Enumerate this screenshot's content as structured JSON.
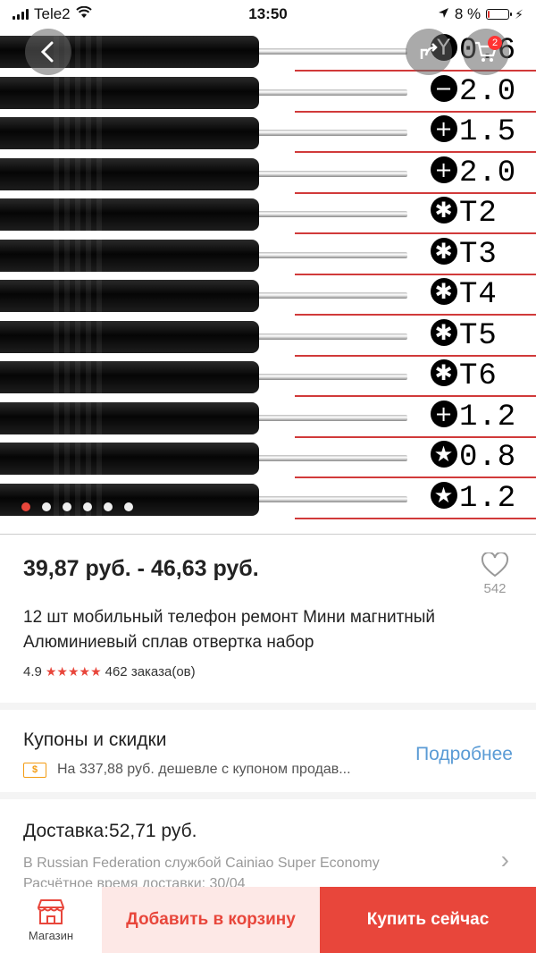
{
  "status_bar": {
    "carrier": "Tele2",
    "time": "13:50",
    "battery_percent": "8 %",
    "battery_level": 0.08
  },
  "gallery": {
    "tool_labels": [
      {
        "icon": "Y",
        "size": "0.6"
      },
      {
        "icon": "−",
        "size": "2.0"
      },
      {
        "icon": "+",
        "size": "1.5"
      },
      {
        "icon": "+",
        "size": "2.0"
      },
      {
        "icon": "✱",
        "size": "T2"
      },
      {
        "icon": "✱",
        "size": "T3"
      },
      {
        "icon": "✱",
        "size": "T4"
      },
      {
        "icon": "✱",
        "size": "T5"
      },
      {
        "icon": "✱",
        "size": "T6"
      },
      {
        "icon": "+",
        "size": "1.2"
      },
      {
        "icon": "★",
        "size": "0.8"
      },
      {
        "icon": "★",
        "size": "1.2"
      }
    ],
    "slide_count": 6,
    "active_slide": 1,
    "cart_count": "2"
  },
  "product": {
    "price": "39,87 руб. - 46,63 руб.",
    "wishlist_count": "542",
    "title": "12 шт мобильный телефон ремонт Мини магнитный Алюминиевый сплав отвертка набор",
    "rating": "4.9",
    "stars": "★★★★★",
    "orders": "462 заказа(ов)"
  },
  "coupons": {
    "title": "Купоны и скидки",
    "icon_text": "$",
    "description": "На 337,88 руб. дешевле с купоном продав...",
    "more": "Подробнее"
  },
  "delivery": {
    "title": "Доставка:52,71 руб.",
    "carrier_line": "В Russian Federation службой Cainiao Super Economy",
    "eta_line": "Расчётное время доставки: 30/04"
  },
  "bottom_bar": {
    "store_label": "Магазин",
    "add_to_cart": "Добавить в корзину",
    "buy_now": "Купить сейчас"
  },
  "colors": {
    "accent": "#e8463b",
    "link": "#5a9bd5",
    "add_cart_bg": "#fde8e6"
  }
}
